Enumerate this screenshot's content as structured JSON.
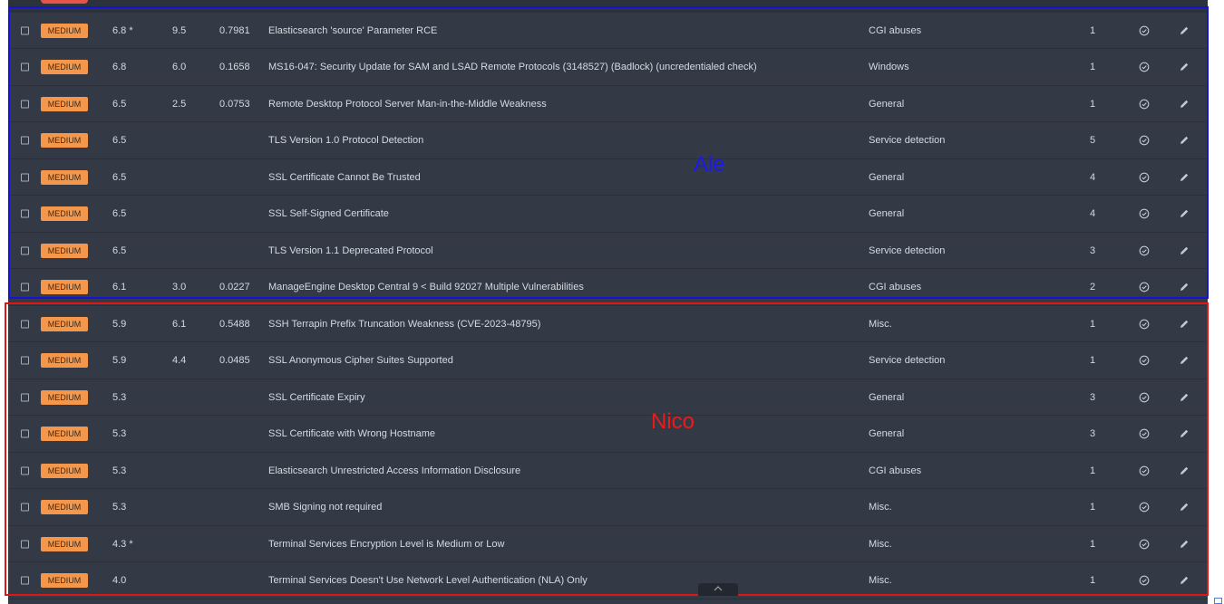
{
  "annotations": {
    "group_a_label": "Ale",
    "group_b_label": "Nico"
  },
  "colors": {
    "severity_medium": "#f5974b",
    "box_ale": "#1414d8",
    "box_nico": "#e01515"
  },
  "icons": {
    "status": "check-circle-icon",
    "edit": "pencil-icon",
    "scroll": "chevron-up-icon"
  },
  "rows": [
    {
      "severity": "MEDIUM",
      "cvss": "6.8 *",
      "vpr": "9.5",
      "epss": "0.7981",
      "name": "Elasticsearch 'source' Parameter RCE",
      "family": "CGI abuses",
      "count": "1"
    },
    {
      "severity": "MEDIUM",
      "cvss": "6.8",
      "vpr": "6.0",
      "epss": "0.1658",
      "name": "MS16-047: Security Update for SAM and LSAD Remote Protocols (3148527) (Badlock) (uncredentialed check)",
      "family": "Windows",
      "count": "1"
    },
    {
      "severity": "MEDIUM",
      "cvss": "6.5",
      "vpr": "2.5",
      "epss": "0.0753",
      "name": "Remote Desktop Protocol Server Man-in-the-Middle Weakness",
      "family": "General",
      "count": "1"
    },
    {
      "severity": "MEDIUM",
      "cvss": "6.5",
      "vpr": "",
      "epss": "",
      "name": "TLS Version 1.0 Protocol Detection",
      "family": "Service detection",
      "count": "5"
    },
    {
      "severity": "MEDIUM",
      "cvss": "6.5",
      "vpr": "",
      "epss": "",
      "name": "SSL Certificate Cannot Be Trusted",
      "family": "General",
      "count": "4"
    },
    {
      "severity": "MEDIUM",
      "cvss": "6.5",
      "vpr": "",
      "epss": "",
      "name": "SSL Self-Signed Certificate",
      "family": "General",
      "count": "4"
    },
    {
      "severity": "MEDIUM",
      "cvss": "6.5",
      "vpr": "",
      "epss": "",
      "name": "TLS Version 1.1 Deprecated Protocol",
      "family": "Service detection",
      "count": "3"
    },
    {
      "severity": "MEDIUM",
      "cvss": "6.1",
      "vpr": "3.0",
      "epss": "0.0227",
      "name": "ManageEngine Desktop Central 9 < Build 92027 Multiple Vulnerabilities",
      "family": "CGI abuses",
      "count": "2"
    },
    {
      "severity": "MEDIUM",
      "cvss": "5.9",
      "vpr": "6.1",
      "epss": "0.5488",
      "name": "SSH Terrapin Prefix Truncation Weakness (CVE-2023-48795)",
      "family": "Misc.",
      "count": "1"
    },
    {
      "severity": "MEDIUM",
      "cvss": "5.9",
      "vpr": "4.4",
      "epss": "0.0485",
      "name": "SSL Anonymous Cipher Suites Supported",
      "family": "Service detection",
      "count": "1"
    },
    {
      "severity": "MEDIUM",
      "cvss": "5.3",
      "vpr": "",
      "epss": "",
      "name": "SSL Certificate Expiry",
      "family": "General",
      "count": "3"
    },
    {
      "severity": "MEDIUM",
      "cvss": "5.3",
      "vpr": "",
      "epss": "",
      "name": "SSL Certificate with Wrong Hostname",
      "family": "General",
      "count": "3"
    },
    {
      "severity": "MEDIUM",
      "cvss": "5.3",
      "vpr": "",
      "epss": "",
      "name": "Elasticsearch Unrestricted Access Information Disclosure",
      "family": "CGI abuses",
      "count": "1"
    },
    {
      "severity": "MEDIUM",
      "cvss": "5.3",
      "vpr": "",
      "epss": "",
      "name": "SMB Signing not required",
      "family": "Misc.",
      "count": "1"
    },
    {
      "severity": "MEDIUM",
      "cvss": "4.3 *",
      "vpr": "",
      "epss": "",
      "name": "Terminal Services Encryption Level is Medium or Low",
      "family": "Misc.",
      "count": "1"
    },
    {
      "severity": "MEDIUM",
      "cvss": "4.0",
      "vpr": "",
      "epss": "",
      "name": "Terminal Services Doesn't Use Network Level Authentication (NLA) Only",
      "family": "Misc.",
      "count": "1"
    }
  ]
}
